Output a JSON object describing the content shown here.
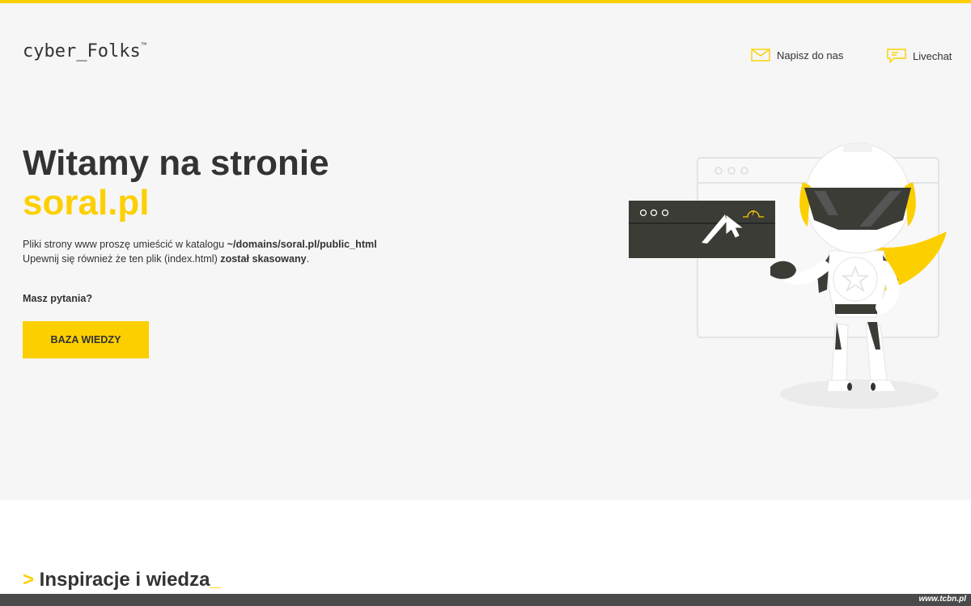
{
  "brand": {
    "name": "cyber_Folks",
    "tm": "™"
  },
  "nav": {
    "mail_label": "Napisz do nas",
    "chat_label": "Livechat"
  },
  "hero": {
    "title_line1": "Witamy na stronie",
    "title_line2": "soral.pl",
    "line1_prefix": "Pliki strony www proszę umieścić w katalogu ",
    "line1_path": "~/domains/soral.pl/public_html",
    "line2_prefix": "Upewnij się również że ten plik (index.html) ",
    "line2_bold": "został skasowany",
    "line2_suffix": ".",
    "question": "Masz pytania?",
    "button_label": "BAZA WIEDZY"
  },
  "section": {
    "arrow": ">",
    "title": " Inspiracje i wiedza",
    "cursor": "_"
  },
  "footer": {
    "watermark": "www.tcbn.pl"
  },
  "colors": {
    "accent": "#fcd000",
    "text": "#333333",
    "hero_bg": "#f6f6f6",
    "footer_bg": "#4a4a4a"
  }
}
